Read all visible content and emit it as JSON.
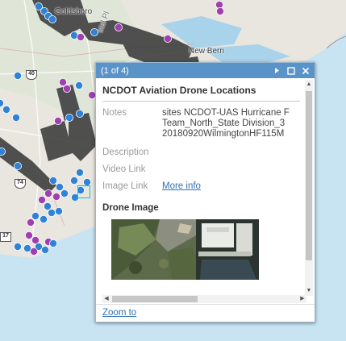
{
  "map": {
    "places": [
      {
        "name": "Goldsboro"
      },
      {
        "name": "New Bern"
      }
    ],
    "shields": [
      "40",
      "74",
      "17"
    ],
    "overlay_text": "stal Pl",
    "colors": {
      "land": "#eceae3",
      "water": "#c8e3f1",
      "flight_swath": "#3b3b3b",
      "point_blue": "#2f82d6",
      "point_purple": "#a040b0"
    }
  },
  "popup": {
    "count": "(1 of 4)",
    "title": "NCDOT Aviation Drone Locations",
    "header_icons": [
      "next-icon",
      "maximize-icon",
      "close-icon"
    ],
    "fields": [
      {
        "key": "Notes",
        "value_lines": [
          "sites NCDOT-UAS Hurricane F",
          "Team_North_State Division_3",
          "20180920WilmingtonHF115M"
        ]
      },
      {
        "key": "Description",
        "value_lines": [
          ""
        ]
      },
      {
        "key": "Video Link",
        "value_lines": [
          ""
        ]
      },
      {
        "key": "Image Link",
        "link": "More info"
      }
    ],
    "media_title": "Drone Image",
    "footer_link": "Zoom to"
  }
}
